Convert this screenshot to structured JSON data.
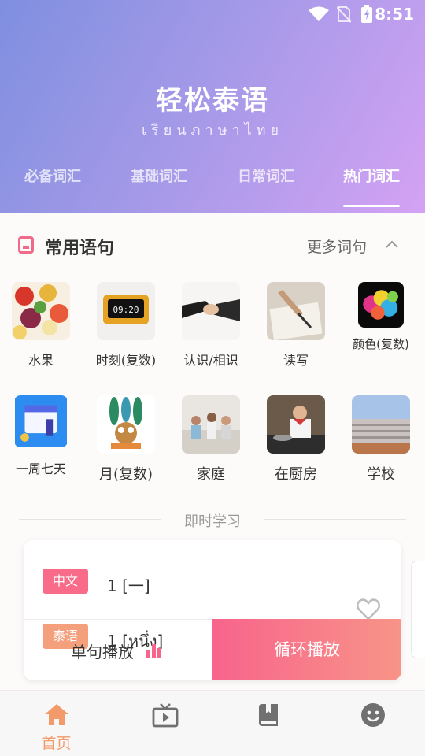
{
  "status_bar": {
    "time": "8:51"
  },
  "app": {
    "title": "轻松泰语",
    "subtitle": "เรียนภาษาไทย"
  },
  "tabs": [
    {
      "label": "必备词汇",
      "active": false
    },
    {
      "label": "基础词汇",
      "active": false
    },
    {
      "label": "日常词汇",
      "active": false
    },
    {
      "label": "热门词汇",
      "active": true
    }
  ],
  "section": {
    "title": "常用语句",
    "more_label": "更多词句"
  },
  "categories": [
    {
      "label": "水果",
      "icon": "fruit-image"
    },
    {
      "label": "时刻(复数)",
      "icon": "clock-image"
    },
    {
      "label": "认识/相识",
      "icon": "handshake-image"
    },
    {
      "label": "读写",
      "icon": "writing-image"
    },
    {
      "label": "颜色(复数)",
      "icon": "color-powder-image"
    },
    {
      "label": "一周七天",
      "icon": "calendar-image"
    },
    {
      "label": "月(复数)",
      "icon": "owl-image"
    },
    {
      "label": "家庭",
      "icon": "family-image"
    },
    {
      "label": "在厨房",
      "icon": "kitchen-image"
    },
    {
      "label": "学校",
      "icon": "school-image"
    }
  ],
  "clock_display": "09:20",
  "instant_learning": {
    "title": "即时学习",
    "chinese_badge": "中文",
    "chinese_text": "1 [一]",
    "thai_badge": "泰语",
    "thai_text": "1 [หนึ่ง]",
    "play_single_label": "单句播放",
    "play_loop_label": "循环播放"
  },
  "bottom_nav": [
    {
      "label": "首页",
      "icon": "home-icon",
      "active": true
    },
    {
      "label": "",
      "icon": "video-icon",
      "active": false
    },
    {
      "label": "",
      "icon": "book-icon",
      "active": false
    },
    {
      "label": "",
      "icon": "profile-icon",
      "active": false
    }
  ],
  "colors": {
    "accent_pink": "#f86c8a",
    "accent_orange": "#f39a6a",
    "header_start": "#7f8fe0",
    "header_end": "#d4a2f4"
  }
}
